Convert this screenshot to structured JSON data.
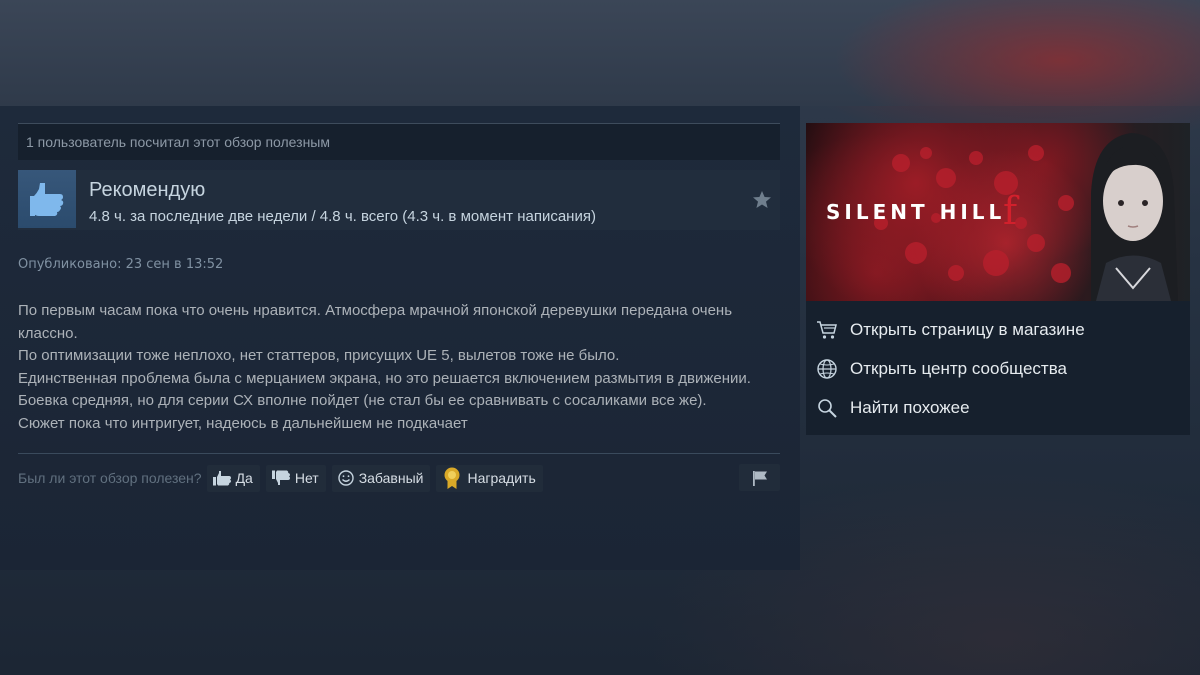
{
  "helpful_count_text": "1 пользователь посчитал этот обзор полезным",
  "recommendation": {
    "title": "Рекомендую",
    "hours": "4.8 ч. за последние две недели / 4.8 ч. всего (4.3 ч. в момент написания)"
  },
  "posted": "Опубликовано: 23 сен в 13:52",
  "review_lines": [
    "По первым часам пока что очень нравится. Атмосфера мрачной японской деревушки передана очень классно.",
    "По оптимизации тоже неплохо, нет статтеров, присущих UE 5, вылетов тоже не было.",
    "Единственная проблема была с мерцанием экрана, но это решается включением размытия в движении.",
    "Боевка средняя, но для серии СХ вполне пойдет (не стал бы ее сравнивать с сосаликами все же).",
    "Сюжет пока что интригует, надеюсь в дальнейшем не подкачает"
  ],
  "vote": {
    "question": "Был ли этот обзор полезен?",
    "yes": "Да",
    "no": "Нет",
    "funny": "Забавный",
    "award": "Наградить"
  },
  "game": {
    "title": "SILENT HILL",
    "title_suffix": "f"
  },
  "panel_links": {
    "store": "Открыть страницу в магазине",
    "community": "Открыть центр сообщества",
    "similar": "Найти похожее"
  },
  "icons": {
    "thumb": "thumbs-up-icon",
    "star": "star-icon",
    "flag": "flag-icon",
    "cart": "cart-icon",
    "globe": "globe-icon",
    "search": "search-icon"
  },
  "colors": {
    "thumb_box": "#2b4b6d",
    "award_gold": "#d9a928",
    "accent_red": "#d2202c"
  }
}
